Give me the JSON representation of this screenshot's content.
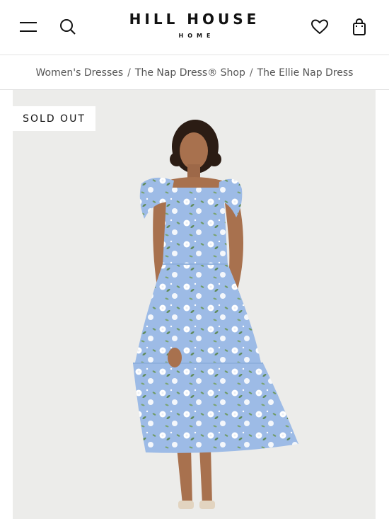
{
  "header": {
    "brand": "HILL HOUSE",
    "brand_sub": "HOME",
    "icons": [
      "menu-icon",
      "search-icon",
      "heart-icon",
      "shopping-bag-icon"
    ]
  },
  "breadcrumb": {
    "items": [
      {
        "label": "Women's Dresses"
      },
      {
        "label": "The Nap Dress® Shop"
      },
      {
        "label": "The Ellie Nap Dress"
      }
    ],
    "separator": "/"
  },
  "product": {
    "badge": "SOLD OUT",
    "image_subject": "model-in-blue-floral-dress"
  },
  "colors": {
    "background": "#ffffff",
    "image_bg": "#ececea",
    "dress_blue": "#9dbbe6",
    "text": "#1a1a1a",
    "muted": "#555555"
  }
}
